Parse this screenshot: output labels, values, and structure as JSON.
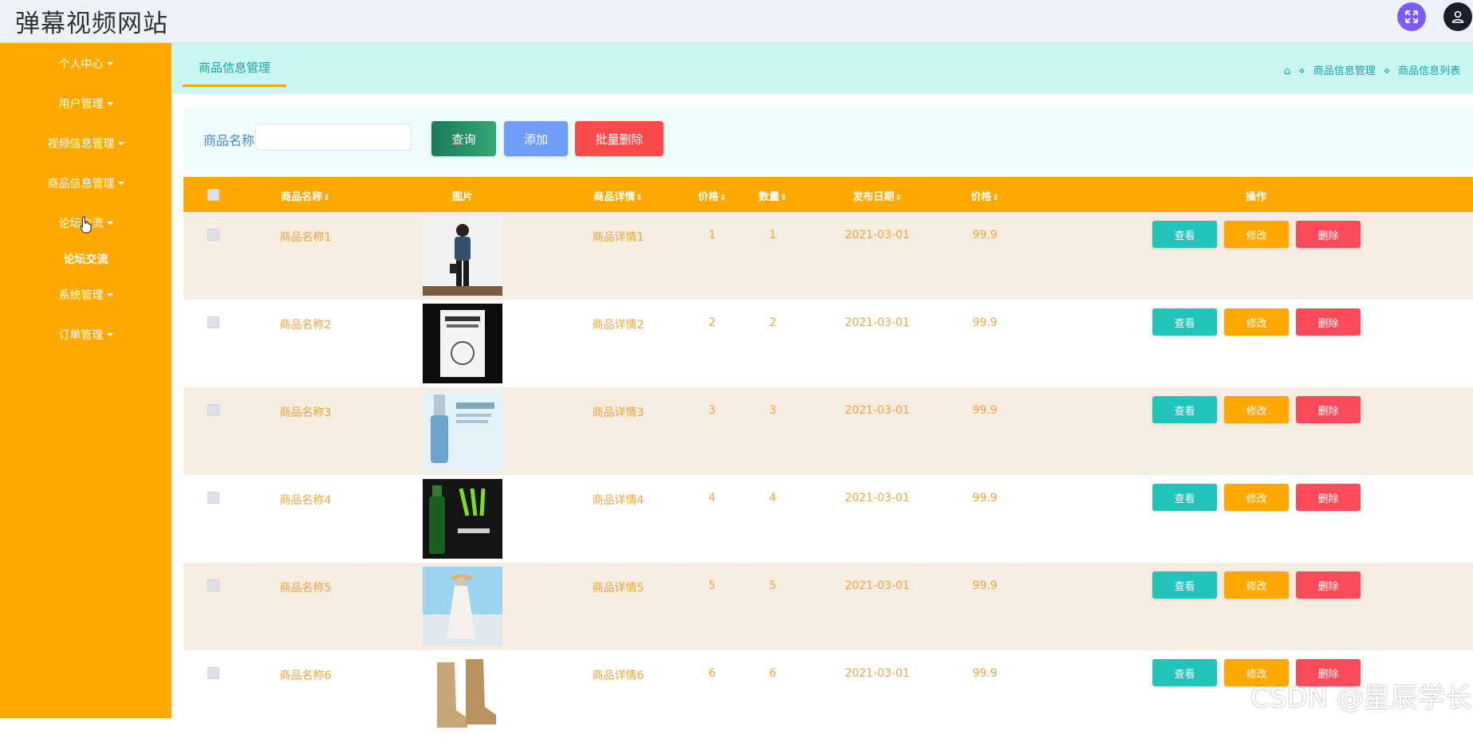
{
  "header": {
    "site_title": "弹幕视频网站",
    "fullscreen_icon": "fullscreen-icon",
    "user_icon": "user-icon"
  },
  "sidebar": {
    "items": [
      {
        "label": "个人中心",
        "has_caret": true
      },
      {
        "label": "用户管理",
        "has_caret": true
      },
      {
        "label": "视频信息管理",
        "has_caret": true
      },
      {
        "label": "商品信息管理",
        "has_caret": true
      },
      {
        "label": "论坛交流",
        "has_caret": true
      },
      {
        "label": "系统管理",
        "has_caret": true
      },
      {
        "label": "订单管理",
        "has_caret": true
      }
    ],
    "submenu": {
      "label": "论坛交流"
    }
  },
  "tabs": {
    "active": "商品信息管理"
  },
  "breadcrumb": {
    "items": [
      "商品信息管理",
      "商品信息列表"
    ]
  },
  "search": {
    "label": "商品名称",
    "value": "",
    "placeholder": "",
    "query_label": "查询",
    "add_label": "添加",
    "batch_delete_label": "批量删除"
  },
  "table": {
    "columns": [
      "商品名称",
      "图片",
      "商品详情",
      "价格",
      "数量",
      "发布日期",
      "价格",
      "操作"
    ],
    "sort_glyph": "⇕",
    "rows": [
      {
        "name": "商品名称1",
        "detail": "商品详情1",
        "price": "1",
        "qty": "1",
        "date": "2021-03-01",
        "price2": "99.9",
        "image": "woman-portrait"
      },
      {
        "name": "商品名称2",
        "detail": "商品详情2",
        "price": "2",
        "qty": "2",
        "date": "2021-03-01",
        "price2": "99.9",
        "image": "book-cover"
      },
      {
        "name": "商品名称3",
        "detail": "商品详情3",
        "price": "3",
        "qty": "3",
        "date": "2021-03-01",
        "price2": "99.9",
        "image": "serum-bottle"
      },
      {
        "name": "商品名称4",
        "detail": "商品详情4",
        "price": "4",
        "qty": "4",
        "date": "2021-03-01",
        "price2": "99.9",
        "image": "energy-drink"
      },
      {
        "name": "商品名称5",
        "detail": "商品详情5",
        "price": "5",
        "qty": "5",
        "date": "2021-03-01",
        "price2": "99.9",
        "image": "beach-dress"
      },
      {
        "name": "商品名称6",
        "detail": "商品详情6",
        "price": "6",
        "qty": "6",
        "date": "2021-03-01",
        "price2": "99.9",
        "image": "boots"
      }
    ],
    "actions": {
      "view": "查看",
      "edit": "修改",
      "delete": "删除"
    }
  },
  "watermark": "CSDN @星辰学长",
  "colors": {
    "sidebar": "#ffa800",
    "tabbar": "#c9f5f2",
    "teal": "#20c4b8",
    "red": "#fb4a5a",
    "odd_row": "#f5ede1"
  }
}
